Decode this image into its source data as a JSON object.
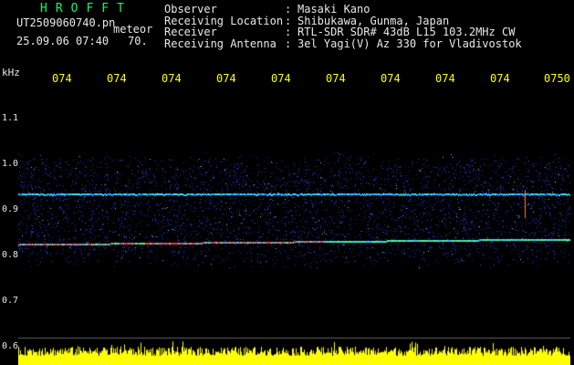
{
  "header": {
    "app_title": "HROFFT",
    "file_name": "UT2509060740.pn",
    "meteor_label": "meteor",
    "datetime": "25.09.06 07:40",
    "value": "70."
  },
  "info": [
    {
      "key": "Observer",
      "sep": ":",
      "value": "Masaki Kano"
    },
    {
      "key": "Receiving Location",
      "sep": ":",
      "value": "Shibukawa, Gunma, Japan"
    },
    {
      "key": "Receiver",
      "sep": ":",
      "value": "RTL-SDR SDR# 43dB L15 103.2MHz CW"
    },
    {
      "key": "Receiving Antenna",
      "sep": ":",
      "value": "3el Yagi(V) Az 330 for Vladivostok"
    }
  ],
  "axis": {
    "freq_unit": "kHz",
    "freq_ticks": [
      "1.1",
      "1.0",
      "0.9",
      "0.8",
      "0.7",
      "0.6"
    ],
    "time_ticks": [
      "074",
      "074",
      "074",
      "074",
      "074",
      "074",
      "074",
      "074",
      "074",
      "0750"
    ]
  },
  "colors": {
    "background": "#000000",
    "title_green": "#00ff66",
    "time_yellow": "#ffff00",
    "text": "#e8e8e8",
    "noise_blue": "#1a3cff",
    "carrier_cyan": "#40e0ff",
    "signal_red": "#ff3030"
  }
}
